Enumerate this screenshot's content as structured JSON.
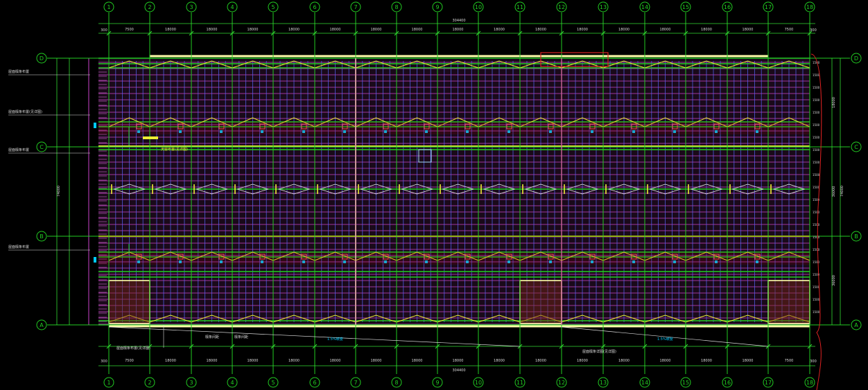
{
  "drawing": {
    "axes_numbers": [
      "1",
      "2",
      "3",
      "4",
      "5",
      "6",
      "7",
      "8",
      "9",
      "10",
      "11",
      "12",
      "13",
      "14",
      "15",
      "16",
      "17",
      "18"
    ],
    "axes_letters": [
      "D",
      "C",
      "B",
      "A"
    ],
    "top_total_dimension": "304400",
    "bottom_total_dimension": "304400",
    "end_offset_dimension": "300",
    "span_dimensions": [
      "7500",
      "18000",
      "18000",
      "18000",
      "18000",
      "18000",
      "18000",
      "18000",
      "18000",
      "18000",
      "18000",
      "18000",
      "18000",
      "18000",
      "18000",
      "18000",
      "7500"
    ],
    "right_row_dimensions": [
      "18000",
      "36000",
      "36000"
    ],
    "right_total_dimension": "74000",
    "left_notes": [
      "屋面檩条布置",
      "屋面檩条布置(见详图)",
      "屋面檩条布置",
      "屋面檩条布置"
    ],
    "bottom_notes": [
      "檩条间距",
      "檩条间距",
      "1.5%坡度",
      "屋面檩条详图(见详图)",
      "1.5%坡度"
    ],
    "row_label_value": "1500",
    "highlight_label": "天窗布置(见详图)",
    "colors": {
      "axis": "#22cc22",
      "dimension": "#33dd33",
      "purlin": "#cc44cc",
      "secondary": "#5566ff",
      "truss": "#eeee33",
      "ridge": "#ff9900",
      "accent": "#00ccff",
      "cloud": "#dd2222",
      "text": "#dddddd"
    }
  }
}
